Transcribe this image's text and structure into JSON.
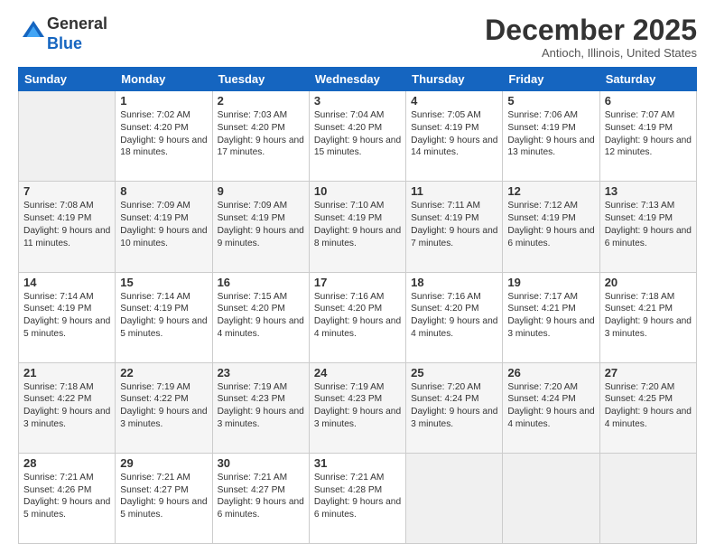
{
  "logo": {
    "general": "General",
    "blue": "Blue"
  },
  "title": "December 2025",
  "location": "Antioch, Illinois, United States",
  "days_of_week": [
    "Sunday",
    "Monday",
    "Tuesday",
    "Wednesday",
    "Thursday",
    "Friday",
    "Saturday"
  ],
  "weeks": [
    [
      {
        "empty": true
      },
      {
        "day": "1",
        "sunrise": "7:02 AM",
        "sunset": "4:20 PM",
        "daylight": "9 hours and 18 minutes."
      },
      {
        "day": "2",
        "sunrise": "7:03 AM",
        "sunset": "4:20 PM",
        "daylight": "9 hours and 17 minutes."
      },
      {
        "day": "3",
        "sunrise": "7:04 AM",
        "sunset": "4:20 PM",
        "daylight": "9 hours and 15 minutes."
      },
      {
        "day": "4",
        "sunrise": "7:05 AM",
        "sunset": "4:19 PM",
        "daylight": "9 hours and 14 minutes."
      },
      {
        "day": "5",
        "sunrise": "7:06 AM",
        "sunset": "4:19 PM",
        "daylight": "9 hours and 13 minutes."
      },
      {
        "day": "6",
        "sunrise": "7:07 AM",
        "sunset": "4:19 PM",
        "daylight": "9 hours and 12 minutes."
      }
    ],
    [
      {
        "day": "7",
        "sunrise": "7:08 AM",
        "sunset": "4:19 PM",
        "daylight": "9 hours and 11 minutes."
      },
      {
        "day": "8",
        "sunrise": "7:09 AM",
        "sunset": "4:19 PM",
        "daylight": "9 hours and 10 minutes."
      },
      {
        "day": "9",
        "sunrise": "7:09 AM",
        "sunset": "4:19 PM",
        "daylight": "9 hours and 9 minutes."
      },
      {
        "day": "10",
        "sunrise": "7:10 AM",
        "sunset": "4:19 PM",
        "daylight": "9 hours and 8 minutes."
      },
      {
        "day": "11",
        "sunrise": "7:11 AM",
        "sunset": "4:19 PM",
        "daylight": "9 hours and 7 minutes."
      },
      {
        "day": "12",
        "sunrise": "7:12 AM",
        "sunset": "4:19 PM",
        "daylight": "9 hours and 6 minutes."
      },
      {
        "day": "13",
        "sunrise": "7:13 AM",
        "sunset": "4:19 PM",
        "daylight": "9 hours and 6 minutes."
      }
    ],
    [
      {
        "day": "14",
        "sunrise": "7:14 AM",
        "sunset": "4:19 PM",
        "daylight": "9 hours and 5 minutes."
      },
      {
        "day": "15",
        "sunrise": "7:14 AM",
        "sunset": "4:19 PM",
        "daylight": "9 hours and 5 minutes."
      },
      {
        "day": "16",
        "sunrise": "7:15 AM",
        "sunset": "4:20 PM",
        "daylight": "9 hours and 4 minutes."
      },
      {
        "day": "17",
        "sunrise": "7:16 AM",
        "sunset": "4:20 PM",
        "daylight": "9 hours and 4 minutes."
      },
      {
        "day": "18",
        "sunrise": "7:16 AM",
        "sunset": "4:20 PM",
        "daylight": "9 hours and 4 minutes."
      },
      {
        "day": "19",
        "sunrise": "7:17 AM",
        "sunset": "4:21 PM",
        "daylight": "9 hours and 3 minutes."
      },
      {
        "day": "20",
        "sunrise": "7:18 AM",
        "sunset": "4:21 PM",
        "daylight": "9 hours and 3 minutes."
      }
    ],
    [
      {
        "day": "21",
        "sunrise": "7:18 AM",
        "sunset": "4:22 PM",
        "daylight": "9 hours and 3 minutes."
      },
      {
        "day": "22",
        "sunrise": "7:19 AM",
        "sunset": "4:22 PM",
        "daylight": "9 hours and 3 minutes."
      },
      {
        "day": "23",
        "sunrise": "7:19 AM",
        "sunset": "4:23 PM",
        "daylight": "9 hours and 3 minutes."
      },
      {
        "day": "24",
        "sunrise": "7:19 AM",
        "sunset": "4:23 PM",
        "daylight": "9 hours and 3 minutes."
      },
      {
        "day": "25",
        "sunrise": "7:20 AM",
        "sunset": "4:24 PM",
        "daylight": "9 hours and 3 minutes."
      },
      {
        "day": "26",
        "sunrise": "7:20 AM",
        "sunset": "4:24 PM",
        "daylight": "9 hours and 4 minutes."
      },
      {
        "day": "27",
        "sunrise": "7:20 AM",
        "sunset": "4:25 PM",
        "daylight": "9 hours and 4 minutes."
      }
    ],
    [
      {
        "day": "28",
        "sunrise": "7:21 AM",
        "sunset": "4:26 PM",
        "daylight": "9 hours and 5 minutes."
      },
      {
        "day": "29",
        "sunrise": "7:21 AM",
        "sunset": "4:27 PM",
        "daylight": "9 hours and 5 minutes."
      },
      {
        "day": "30",
        "sunrise": "7:21 AM",
        "sunset": "4:27 PM",
        "daylight": "9 hours and 6 minutes."
      },
      {
        "day": "31",
        "sunrise": "7:21 AM",
        "sunset": "4:28 PM",
        "daylight": "9 hours and 6 minutes."
      },
      {
        "empty": true
      },
      {
        "empty": true
      },
      {
        "empty": true
      }
    ]
  ]
}
